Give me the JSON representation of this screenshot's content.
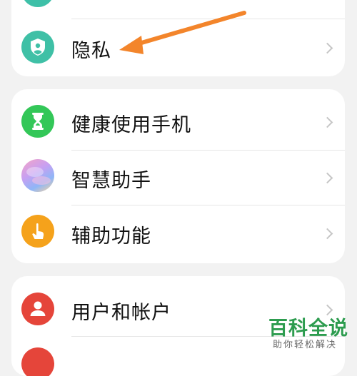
{
  "groups": [
    {
      "items": [
        {
          "label": "",
          "icon": "partial-teal-icon",
          "color": "#3ec0a8"
        },
        {
          "label": "隐私",
          "icon": "privacy-shield-icon",
          "color": "#3fc0a6"
        }
      ]
    },
    {
      "items": [
        {
          "label": "健康使用手机",
          "icon": "hourglass-icon",
          "color": "#33c758"
        },
        {
          "label": "智慧助手",
          "icon": "smart-assistant-icon",
          "color": "#b28cf0"
        },
        {
          "label": "辅助功能",
          "icon": "hand-tap-icon",
          "color": "#f5a21b"
        }
      ]
    },
    {
      "items": [
        {
          "label": "用户和帐户",
          "icon": "user-account-icon",
          "color": "#e5453a"
        },
        {
          "label": "",
          "icon": "partial-red-icon",
          "color": "#e5453a"
        }
      ]
    }
  ],
  "annotation": {
    "type": "orange-arrow",
    "color": "#f3852b",
    "points_to": "隐私"
  },
  "watermark": {
    "title": "百科全说",
    "subtitle": "助你轻松解决",
    "color": "#2d9c4f"
  }
}
